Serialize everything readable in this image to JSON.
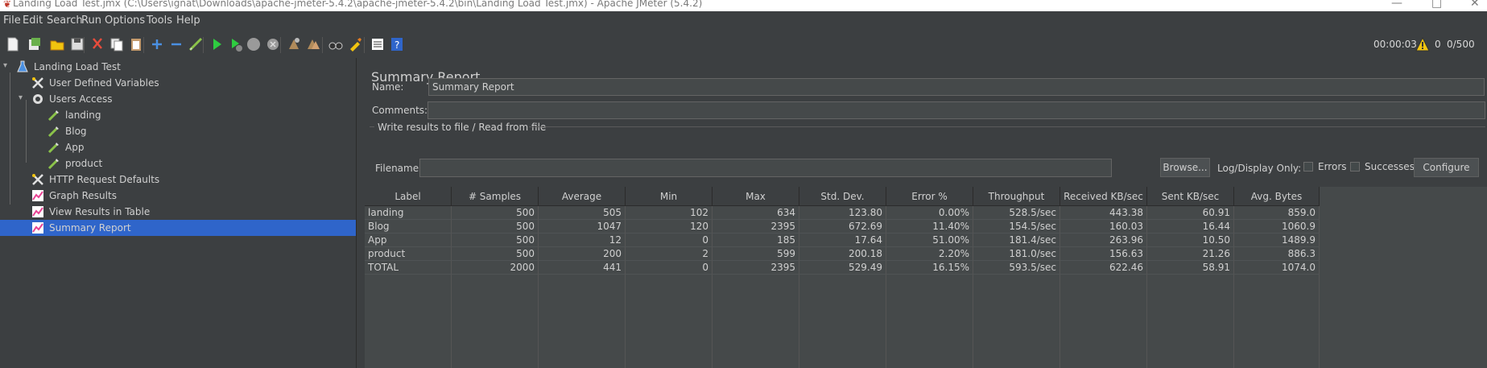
{
  "window": {
    "title": "Landing Load Test.jmx (C:\\Users\\ignat\\Downloads\\apache-jmeter-5.4.2\\apache-jmeter-5.4.2\\bin\\Landing Load Test.jmx) - Apache JMeter (5.4.2)",
    "minimize": "—",
    "maximize": "□",
    "close": "✕"
  },
  "menu": [
    "File",
    "Edit",
    "Search",
    "Run",
    "Options",
    "Tools",
    "Help"
  ],
  "status": {
    "elapsed": "00:00:03",
    "warnings": "0",
    "threads": "0/500"
  },
  "tree": [
    {
      "label": "Landing Load Test",
      "icon": "flask-icon"
    },
    {
      "label": "User Defined Variables",
      "icon": "tools-icon"
    },
    {
      "label": "Users Access",
      "icon": "gear-icon"
    },
    {
      "label": "landing",
      "icon": "pipette-icon"
    },
    {
      "label": "Blog",
      "icon": "pipette-icon"
    },
    {
      "label": "App",
      "icon": "pipette-icon"
    },
    {
      "label": "product",
      "icon": "pipette-icon"
    },
    {
      "label": "HTTP Request Defaults",
      "icon": "tools-icon"
    },
    {
      "label": "Graph Results",
      "icon": "chart-icon"
    },
    {
      "label": "View Results in Table",
      "icon": "chart-icon"
    },
    {
      "label": "Summary Report",
      "icon": "chart-icon"
    }
  ],
  "panel": {
    "title": "Summary Report",
    "name_label": "Name:",
    "name_value": "Summary Report",
    "comments_label": "Comments:",
    "comments_value": "",
    "file_section_legend": "Write results to file / Read from file",
    "filename_label": "Filename",
    "filename_value": "",
    "browse_button": "Browse...",
    "log_display_label": "Log/Display Only:",
    "errors_label": "Errors",
    "successes_label": "Successes",
    "configure_button": "Configure"
  },
  "table": {
    "columns": [
      "Label",
      "# Samples",
      "Average",
      "Min",
      "Max",
      "Std. Dev.",
      "Error %",
      "Throughput",
      "Received KB/sec",
      "Sent KB/sec",
      "Avg. Bytes"
    ],
    "rows": [
      [
        "landing",
        "500",
        "505",
        "102",
        "634",
        "123.80",
        "0.00%",
        "528.5/sec",
        "443.38",
        "60.91",
        "859.0"
      ],
      [
        "Blog",
        "500",
        "1047",
        "120",
        "2395",
        "672.69",
        "11.40%",
        "154.5/sec",
        "160.03",
        "16.44",
        "1060.9"
      ],
      [
        "App",
        "500",
        "12",
        "0",
        "185",
        "17.64",
        "51.00%",
        "181.4/sec",
        "263.96",
        "10.50",
        "1489.9"
      ],
      [
        "product",
        "500",
        "200",
        "2",
        "599",
        "200.18",
        "2.20%",
        "181.0/sec",
        "156.63",
        "21.26",
        "886.3"
      ],
      [
        "TOTAL",
        "2000",
        "441",
        "0",
        "2395",
        "529.49",
        "16.15%",
        "593.5/sec",
        "622.46",
        "58.91",
        "1074.0"
      ]
    ]
  },
  "colors": {
    "background": "#3c3f41",
    "selection": "#2f65ca",
    "field": "#45494a",
    "text": "#d0d0d0"
  }
}
